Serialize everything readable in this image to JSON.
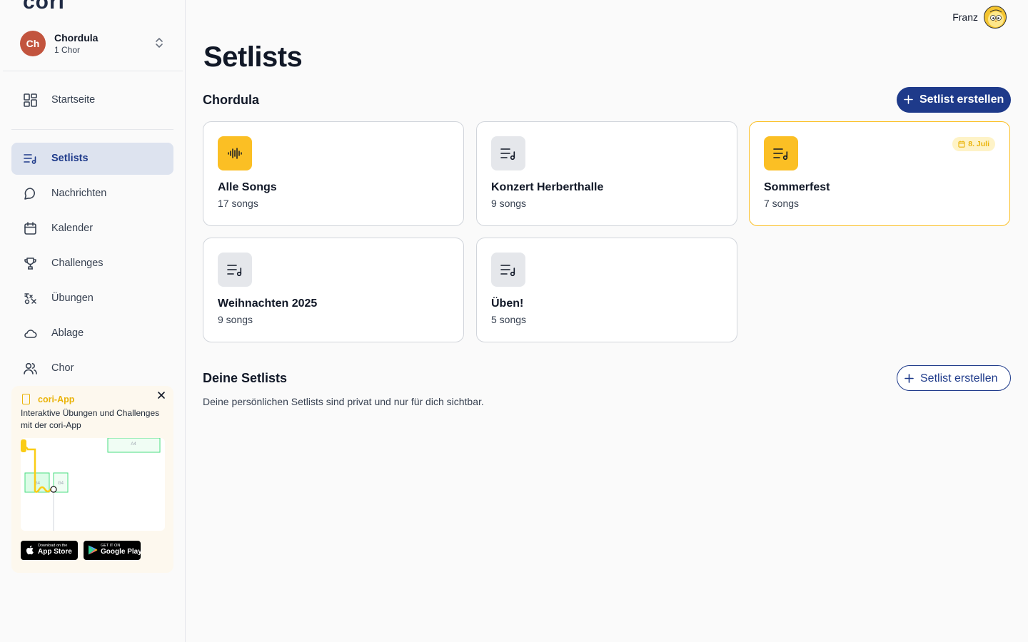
{
  "sidebar": {
    "logo": "cori",
    "choir": {
      "initials": "Ch",
      "name": "Chordula",
      "count": "1 Chor"
    },
    "home": {
      "label": "Startseite"
    },
    "items": [
      {
        "label": "Setlists",
        "icon": "setlist-icon",
        "active": true
      },
      {
        "label": "Nachrichten",
        "icon": "message-icon"
      },
      {
        "label": "Kalender",
        "icon": "calendar-icon"
      },
      {
        "label": "Challenges",
        "icon": "trophy-icon"
      },
      {
        "label": "Übungen",
        "icon": "exercise-icon"
      },
      {
        "label": "Ablage",
        "icon": "cloud-icon"
      },
      {
        "label": "Chor",
        "icon": "users-icon"
      }
    ],
    "promo": {
      "title": "cori-App",
      "text": "Interaktive Übungen und Challenges mit der cori-App",
      "appstore_small": "Download on the",
      "appstore_big": "App Store",
      "googleplay_small": "GET IT ON",
      "googleplay_big": "Google Play",
      "notes": [
        "A4",
        "G4",
        "G4"
      ]
    }
  },
  "header": {
    "user_name": "Franz"
  },
  "main": {
    "title": "Setlists",
    "choir_section": {
      "title": "Chordula",
      "create_label": "Setlist erstellen",
      "cards": [
        {
          "name": "Alle Songs",
          "count": "17 songs",
          "icon": "audio-wave-icon",
          "highlight": true
        },
        {
          "name": "Konzert Herberthalle",
          "count": "9 songs",
          "icon": "setlist-icon"
        },
        {
          "name": "Sommerfest",
          "count": "7 songs",
          "icon": "setlist-icon",
          "highlight": true,
          "date": "8. Juli"
        },
        {
          "name": "Weihnachten 2025",
          "count": "9 songs",
          "icon": "setlist-icon"
        },
        {
          "name": "Üben!",
          "count": "5 songs",
          "icon": "setlist-icon"
        }
      ]
    },
    "personal_section": {
      "title": "Deine Setlists",
      "create_label": "Setlist erstellen",
      "description": "Deine persönlichen Setlists sind privat und nur für dich sichtbar."
    }
  },
  "colors": {
    "primary": "#1e3a8a",
    "accent": "#fbbf24",
    "avatar": "#c2543e"
  }
}
